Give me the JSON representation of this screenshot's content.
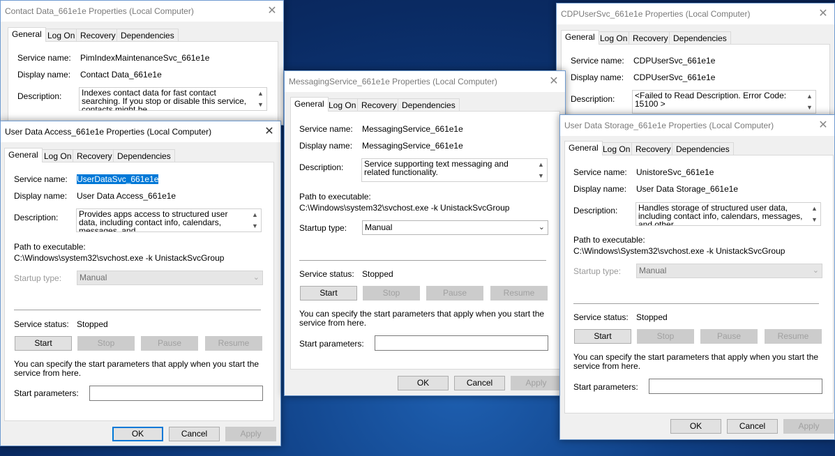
{
  "tabs": {
    "general": "General",
    "logon": "Log On",
    "recovery": "Recovery",
    "dependencies": "Dependencies"
  },
  "labels": {
    "service_name": "Service name:",
    "display_name": "Display name:",
    "description": "Description:",
    "path": "Path to executable:",
    "startup_type": "Startup type:",
    "service_status": "Service status:",
    "start_params_hint": "You can specify the start parameters that apply when you start the service from here.",
    "start_params": "Start parameters:"
  },
  "buttons": {
    "start": "Start",
    "stop": "Stop",
    "pause": "Pause",
    "resume": "Resume",
    "ok": "OK",
    "cancel": "Cancel",
    "apply": "Apply"
  },
  "windows": {
    "contact": {
      "title": "Contact Data_661e1e Properties (Local Computer)",
      "service_name": "PimIndexMaintenanceSvc_661e1e",
      "display_name": "Contact Data_661e1e",
      "description": "Indexes contact data for fast contact searching. If you stop or disable this service, contacts might be"
    },
    "userdata": {
      "title": "User Data Access_661e1e Properties (Local Computer)",
      "service_name": "UserDataSvc_661e1e",
      "display_name": "User Data Access_661e1e",
      "description": "Provides apps access to structured user data, including contact info, calendars, messages, and",
      "path": "C:\\Windows\\system32\\svchost.exe -k UnistackSvcGroup",
      "startup_type": "Manual",
      "status": "Stopped"
    },
    "messaging": {
      "title": "MessagingService_661e1e Properties (Local Computer)",
      "service_name": "MessagingService_661e1e",
      "display_name": "MessagingService_661e1e",
      "description": "Service supporting text messaging and related functionality.",
      "path": "C:\\Windows\\system32\\svchost.exe -k UnistackSvcGroup",
      "startup_type": "Manual",
      "status": "Stopped"
    },
    "cdp": {
      "title": "CDPUserSvc_661e1e Properties (Local Computer)",
      "service_name": "CDPUserSvc_661e1e",
      "display_name": "CDPUserSvc_661e1e",
      "description": "<Failed to Read Description. Error Code: 15100 >"
    },
    "storage": {
      "title": "User Data Storage_661e1e Properties (Local Computer)",
      "service_name": "UnistoreSvc_661e1e",
      "display_name": "User Data Storage_661e1e",
      "description": "Handles storage of structured user data, including contact info, calendars, messages, and other",
      "path": "C:\\Windows\\System32\\svchost.exe -k UnistackSvcGroup",
      "startup_type": "Manual",
      "status": "Stopped"
    }
  }
}
